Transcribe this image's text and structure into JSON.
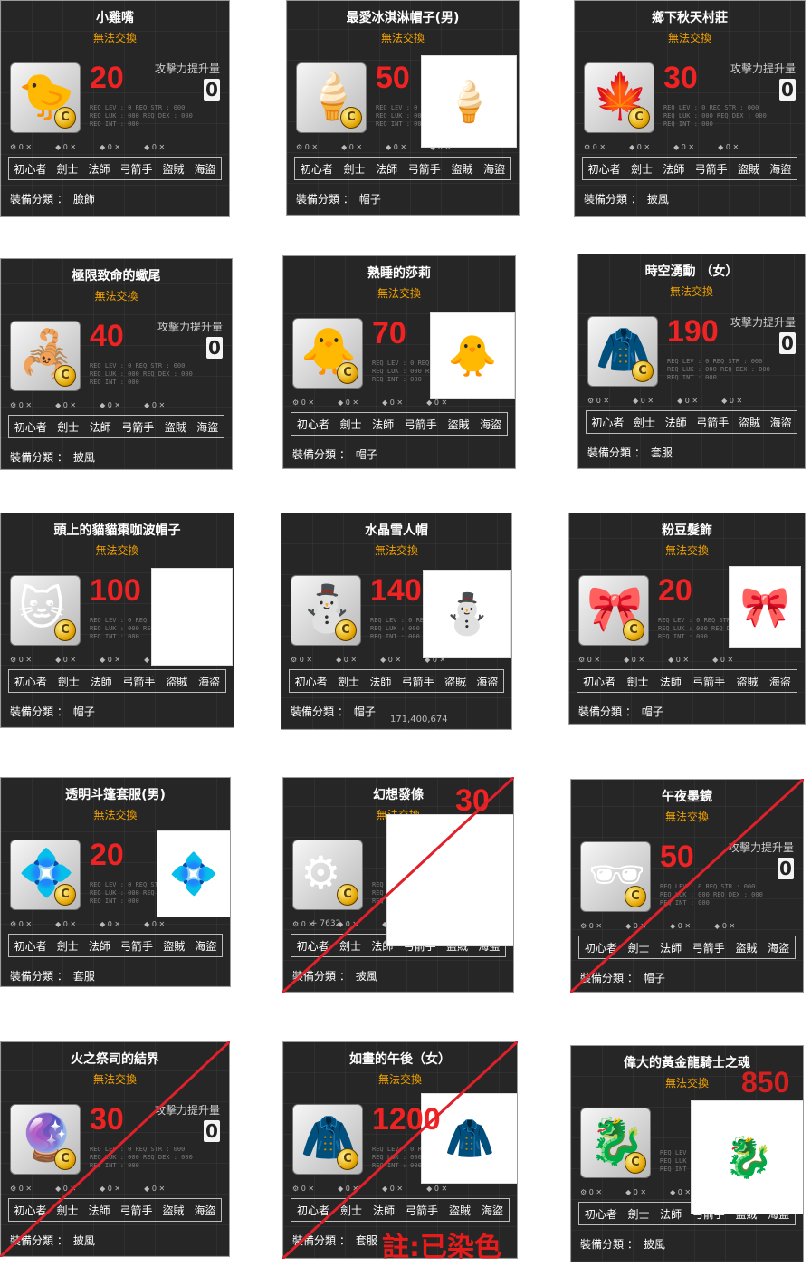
{
  "labels": {
    "atk_label": "攻擊力提升量",
    "cat_prefix": "裝備分類 ：",
    "stat_text": "REQ LEV : 0    REQ STR : 000  REQ LUK : 000    REQ DEX : 000  REQ INT : 000"
  },
  "jobs": [
    "初心者",
    "劍士",
    "法師",
    "弓箭手",
    "盜賊",
    "海盜"
  ],
  "cards": [
    {
      "name": "小雞嘴",
      "trade": "無法交換",
      "price": "20",
      "category": "臉飾",
      "atk": "0",
      "icon": "chick-beak-icon",
      "glyph": "🐤",
      "preview": null,
      "crossed": false
    },
    {
      "name": "最愛冰淇淋帽子(男)",
      "trade": "無法交換",
      "price": "50",
      "category": "帽子",
      "atk": null,
      "icon": "ice-cream-hat-icon",
      "glyph": "🍦",
      "preview": "ice-cream-girl-avatar",
      "crossed": false
    },
    {
      "name": "鄉下秋天村莊",
      "trade": "無法交換",
      "price": "30",
      "category": "披風",
      "atk": "0",
      "icon": "autumn-village-icon",
      "glyph": "🍁",
      "preview": null,
      "crossed": false
    },
    {
      "name": "極限致命的蠍尾",
      "trade": "無法交換",
      "price": "40",
      "category": "披風",
      "atk": "0",
      "icon": "scorpion-tail-icon",
      "glyph": "🦂",
      "preview": null,
      "crossed": false
    },
    {
      "name": "熟睡的莎莉",
      "trade": "無法交換",
      "price": "70",
      "category": "帽子",
      "atk": null,
      "icon": "sleeping-duck-icon",
      "glyph": "🐥",
      "preview": "duck-hat-girl-avatar",
      "crossed": false
    },
    {
      "name": "時空湧動 （女）",
      "trade": "無法交換",
      "price": "190",
      "category": "套服",
      "atk": "0",
      "icon": "hooded-cloak-icon",
      "glyph": "🧥",
      "preview": null,
      "crossed": false
    },
    {
      "name": "頭上的貓貓棗咖波帽子",
      "trade": "無法交換",
      "price": "100",
      "category": "帽子",
      "atk": null,
      "icon": "blue-cat-hat-icon",
      "glyph": "🐱",
      "preview": "blue-cat-girl-avatar",
      "crossed": false
    },
    {
      "name": "水晶雪人帽",
      "trade": "無法交換",
      "price": "140",
      "category": "帽子",
      "atk": null,
      "icon": "snowman-hat-icon",
      "glyph": "⛄",
      "preview": "snowman-hat-girl-avatar",
      "crossed": false,
      "extra": "171,400,674"
    },
    {
      "name": "粉豆髮飾",
      "trade": "無法交換",
      "price": "20",
      "category": "帽子",
      "atk": null,
      "icon": "pink-bean-hairpin-icon",
      "glyph": "🎀",
      "preview": "white-hair-girl-avatar",
      "crossed": false
    },
    {
      "name": "透明斗篷套服(男)",
      "trade": "無法交換",
      "price": "20",
      "category": "套服",
      "atk": null,
      "icon": "transparent-cloak-icon",
      "glyph": "💠",
      "preview": "deer-antler-boy-avatar",
      "crossed": false
    },
    {
      "name": "幻想發條",
      "trade": "無法交換",
      "price": "30",
      "category": "披風",
      "atk": null,
      "icon": "fantasy-clockwork-icon",
      "glyph": "⚙",
      "preview": "clockwork-girl-avatar",
      "crossed": true,
      "extra": "+ 7632"
    },
    {
      "name": "午夜墨鏡",
      "trade": "無法交換",
      "price": "50",
      "category": "帽子",
      "atk": "0",
      "icon": "midnight-sunglasses-icon",
      "glyph": "🕶",
      "preview": null,
      "crossed": true
    },
    {
      "name": "火之祭司的結界",
      "trade": "無法交換",
      "price": "30",
      "category": "披風",
      "atk": "0",
      "icon": "fire-barrier-icon",
      "glyph": "🔮",
      "preview": null,
      "crossed": true
    },
    {
      "name": "如畫的午後（女）",
      "trade": "無法交換",
      "price": "1200",
      "category": "套服",
      "atk": null,
      "icon": "brown-coat-icon",
      "glyph": "🧥",
      "preview": "purple-hair-girl-avatar",
      "crossed": true,
      "note": "註:已染色"
    },
    {
      "name": "偉大的黃金龍騎士之魂",
      "trade": "無法交換",
      "price": "850",
      "category": "披風",
      "atk": null,
      "icon": "golden-dragon-icon",
      "glyph": "🐉",
      "preview": "golden-dragon-knight-avatar",
      "crossed": false
    }
  ]
}
